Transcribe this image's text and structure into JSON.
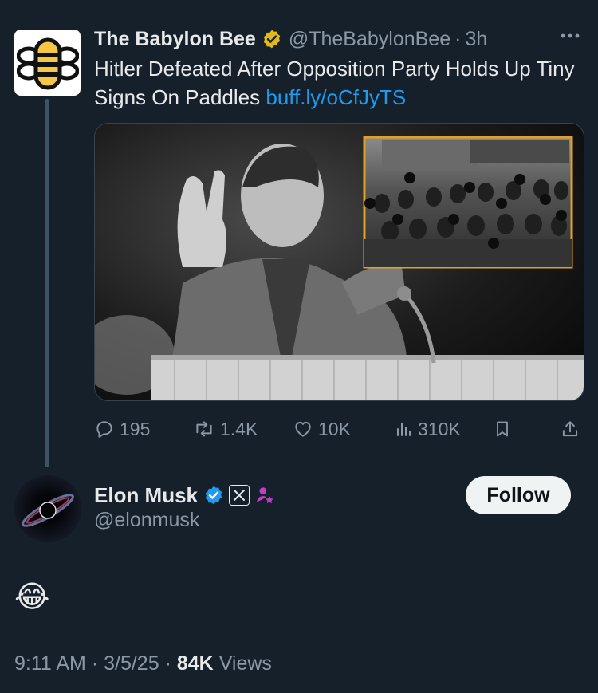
{
  "parent_tweet": {
    "author_name": "The Babylon Bee",
    "handle": "@TheBabylonBee",
    "time": "3h",
    "text": "Hitler Defeated After Opposition Party Holds Up Tiny Signs On Paddles",
    "link": "buff.ly/oCfJyTS",
    "more_icon": "more-horizontal-icon",
    "badge_color": "#e2b719",
    "stats": {
      "replies": "195",
      "reposts": "1.4K",
      "likes": "10K",
      "views": "310K"
    }
  },
  "reply": {
    "author_name": "Elon Musk",
    "handle": "@elonmusk",
    "follow_label": "Follow",
    "badge_color": "#1d9bf0",
    "text": "😂",
    "time": "9:11 AM",
    "date": "3/5/25",
    "views_count": "84K",
    "views_label": "Views"
  },
  "colors": {
    "background": "#15202b",
    "link": "#1d9bf0",
    "muted": "#8b98a5",
    "inset_border": "#e0a12a"
  }
}
